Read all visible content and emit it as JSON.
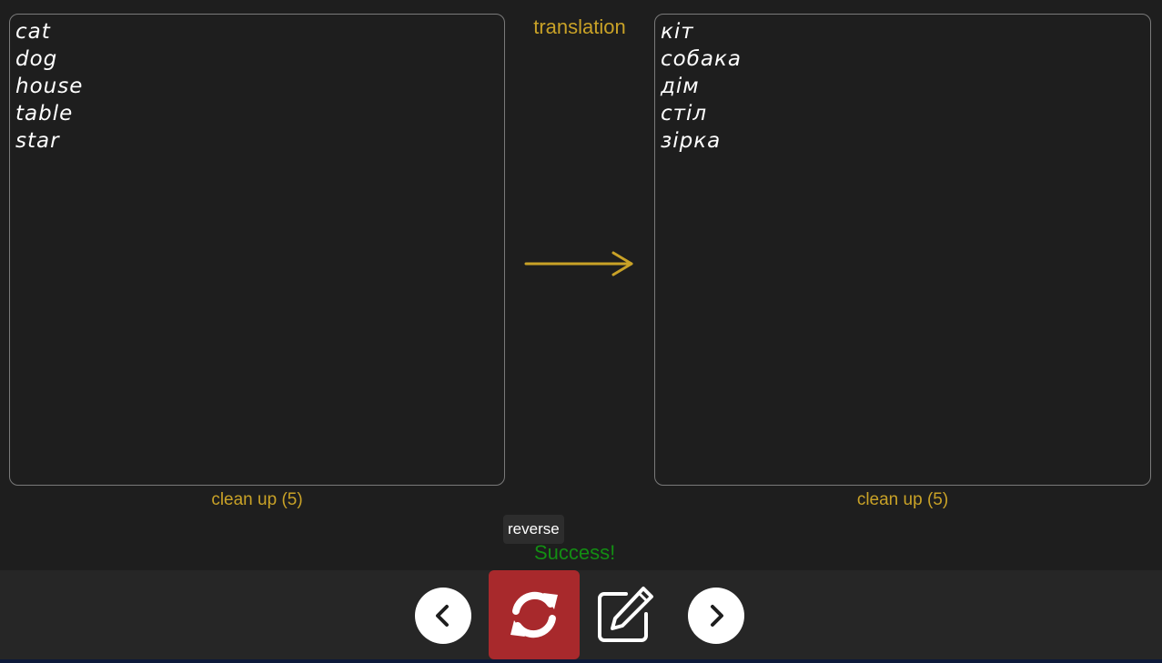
{
  "source": {
    "words": [
      "cat",
      "dog",
      "house",
      "table",
      "star"
    ],
    "cleanup_label": "clean up (5)"
  },
  "middle": {
    "title": "translation",
    "arrow_icon": "arrow-right-icon"
  },
  "target": {
    "words": [
      "кіт",
      "собака",
      "дім",
      "стіл",
      "зірка"
    ],
    "cleanup_label": "clean up (5)"
  },
  "tooltip": {
    "text": "reverse"
  },
  "status": {
    "text": "Success!",
    "color": "#138d13"
  },
  "toolbar": {
    "prev_icon": "chevron-left-icon",
    "reverse_icon": "sync-icon",
    "edit_icon": "edit-icon",
    "next_icon": "chevron-right-icon"
  },
  "colors": {
    "accent": "#c9a227",
    "reverse_button": "#a8292c",
    "background": "#1e1e1e"
  }
}
